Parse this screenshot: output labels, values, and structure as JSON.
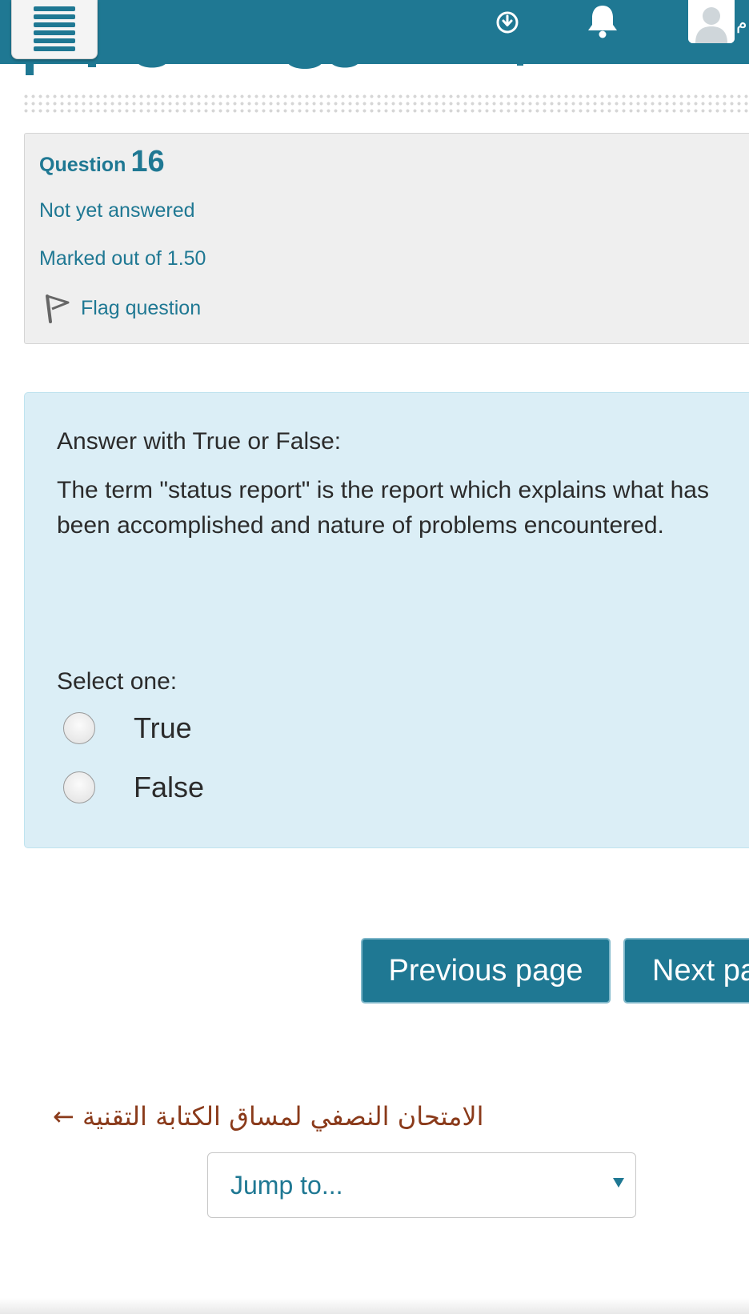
{
  "colors": {
    "brand": "#1f7893",
    "info_box_bg": "#efefef",
    "content_bg": "#dbeef6",
    "link_brown": "#8a3a1a"
  },
  "navbar": {
    "menu_icon": "hamburger-icon",
    "download_icon": "download-circle-icon",
    "notification_icon": "bell-icon",
    "avatar_icon": "user-avatar-icon",
    "user_initial": "م"
  },
  "question": {
    "label": "Question",
    "number": "16",
    "status": "Not yet answered",
    "marks": "Marked out of 1.50",
    "flag_label": "Flag question",
    "instruction": "Answer with True or False:",
    "text": "The term \"status report\" is the report which explains what has been accomplished and nature of problems encountered.",
    "select_prompt": "Select one:",
    "options": [
      {
        "label": "True",
        "selected": false
      },
      {
        "label": "False",
        "selected": false
      }
    ]
  },
  "navigation": {
    "previous_label": "Previous page",
    "next_label": "Next page"
  },
  "footer": {
    "return_link": "← الامتحان النصفي لمساق الكتابة التقنية",
    "jump_label": "Jump to..."
  }
}
